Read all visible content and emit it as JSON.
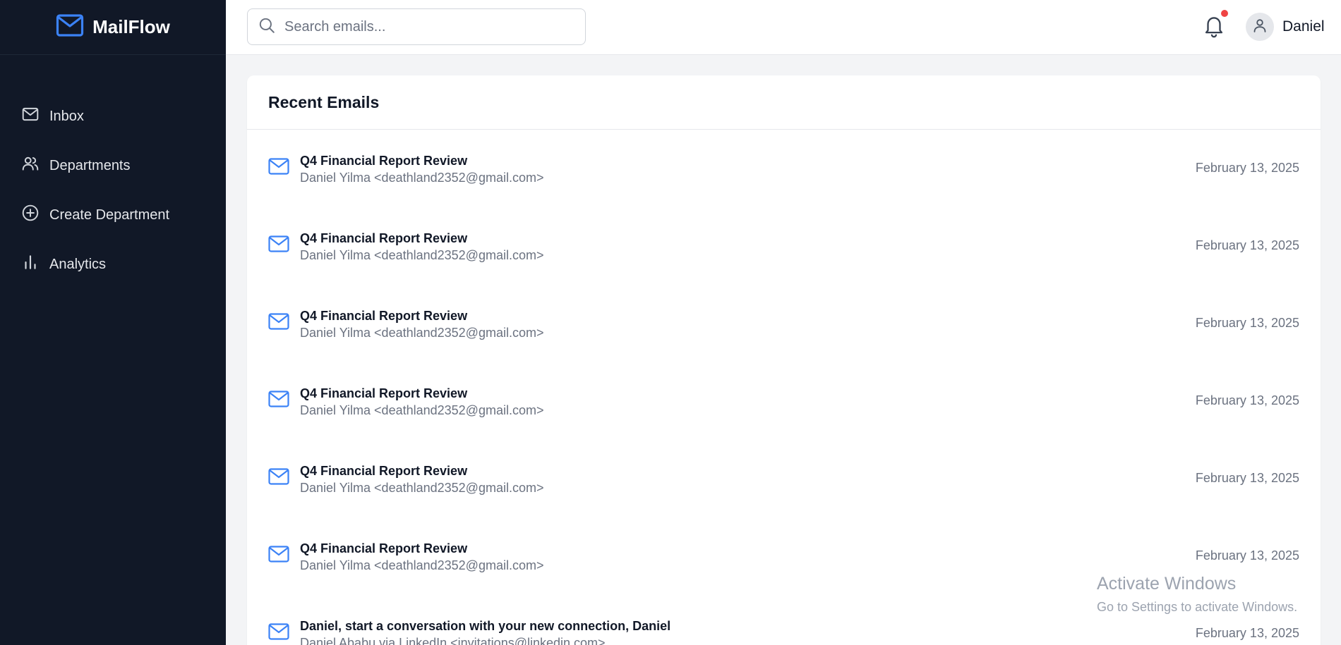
{
  "app": {
    "name": "MailFlow",
    "brand_color": "#3b82f6",
    "sidebar_bg": "#111827"
  },
  "sidebar": {
    "items": [
      {
        "label": "Inbox",
        "icon": "mail-icon"
      },
      {
        "label": "Departments",
        "icon": "users-icon"
      },
      {
        "label": "Create Department",
        "icon": "plus-circle-icon"
      },
      {
        "label": "Analytics",
        "icon": "bar-chart-icon"
      }
    ]
  },
  "header": {
    "search_placeholder": "Search emails...",
    "notifications_icon": "bell-icon",
    "has_unread_notifications": true,
    "user_name": "Daniel"
  },
  "main": {
    "title": "Recent Emails",
    "emails": [
      {
        "subject": "Q4 Financial Report Review",
        "from": "Daniel Yilma <deathland2352@gmail.com>",
        "date": "February 13, 2025"
      },
      {
        "subject": "Q4 Financial Report Review",
        "from": "Daniel Yilma <deathland2352@gmail.com>",
        "date": "February 13, 2025"
      },
      {
        "subject": "Q4 Financial Report Review",
        "from": "Daniel Yilma <deathland2352@gmail.com>",
        "date": "February 13, 2025"
      },
      {
        "subject": "Q4 Financial Report Review",
        "from": "Daniel Yilma <deathland2352@gmail.com>",
        "date": "February 13, 2025"
      },
      {
        "subject": "Q4 Financial Report Review",
        "from": "Daniel Yilma <deathland2352@gmail.com>",
        "date": "February 13, 2025"
      },
      {
        "subject": "Q4 Financial Report Review",
        "from": "Daniel Yilma <deathland2352@gmail.com>",
        "date": "February 13, 2025"
      },
      {
        "subject": "Daniel, start a conversation with your new connection, Daniel",
        "from": "Daniel Ababu via LinkedIn <invitations@linkedin.com>",
        "date": "February 13, 2025"
      }
    ]
  },
  "watermark": {
    "title": "Activate Windows",
    "subtitle": "Go to Settings to activate Windows."
  }
}
